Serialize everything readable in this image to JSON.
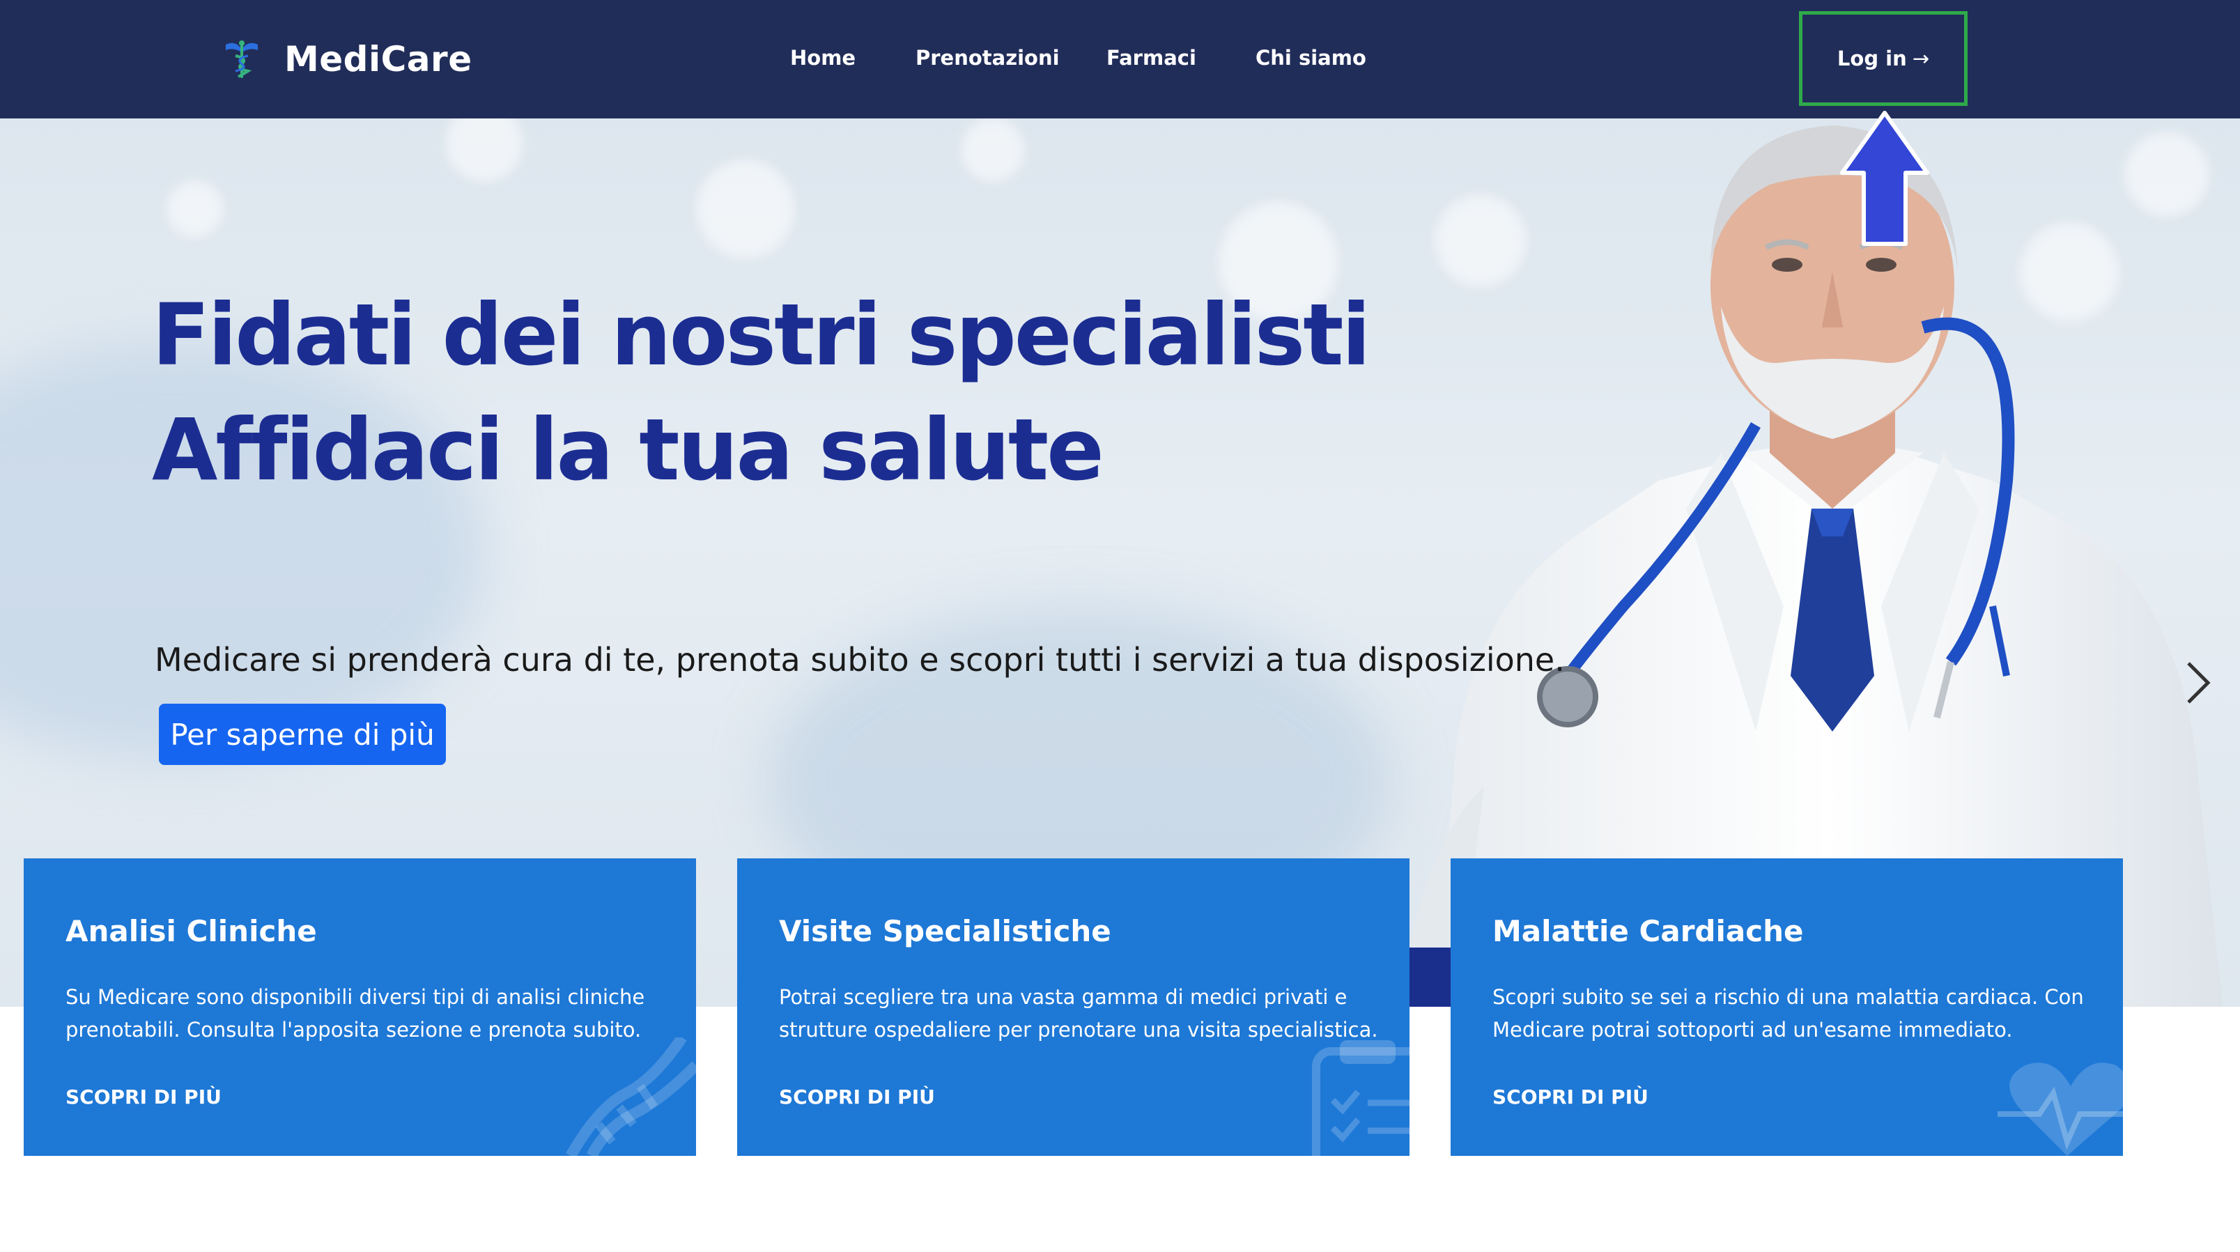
{
  "brand": {
    "name": "MediCare",
    "logo_icon": "caduceus-icon"
  },
  "nav": {
    "items": [
      {
        "label": "Home"
      },
      {
        "label": "Prenotazioni"
      },
      {
        "label": "Farmaci"
      },
      {
        "label": "Chi siamo"
      }
    ],
    "login_label": "Log in",
    "login_arrow": "→"
  },
  "hero": {
    "headline_1": "Fidati dei nostri specialisti",
    "headline_2": "Affidaci la tua salute",
    "subtitle": "Medicare si prenderà cura di te, prenota subito e scopri tutti i servizi a tua disposizione.",
    "cta_label": "Per saperne di più"
  },
  "cards": [
    {
      "title": "Analisi Cliniche",
      "text": "Su Medicare sono disponibili diversi tipi di analisi cliniche prenotabili. Consulta l'apposita sezione e prenota subito.",
      "link": "SCOPRI DI PIÙ",
      "icon": "dna-icon"
    },
    {
      "title": "Visite Specialistiche",
      "text": "Potrai scegliere tra una vasta gamma di medici privati e strutture ospedaliere per prenotare una visita specialistica.",
      "link": "SCOPRI DI PIÙ",
      "icon": "clipboard-icon"
    },
    {
      "title": "Malattie Cardiache",
      "text": "Scopri subito se sei a rischio di una malattia cardiaca. Con Medicare potrai sottoporti ad un'esame immediato.",
      "link": "SCOPRI DI PIÙ",
      "icon": "heartbeat-icon"
    }
  ],
  "colors": {
    "navbar": "#212d59",
    "headline": "#1c2d92",
    "cta": "#1565f0",
    "card": "#1e78d6",
    "highlight_border": "#2faa4a",
    "annotation_arrow": "#3346d6"
  }
}
